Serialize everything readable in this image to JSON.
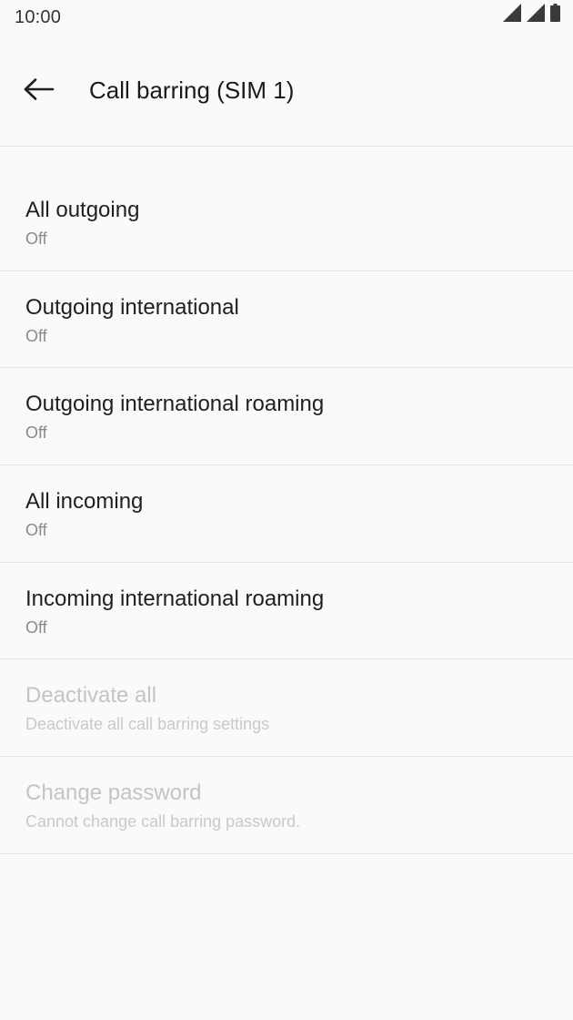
{
  "status_bar": {
    "time": "10:00",
    "icons": [
      "signal-icon",
      "signal-icon",
      "battery-icon"
    ]
  },
  "toolbar": {
    "back_icon": "arrow-back-icon",
    "title": "Call barring (SIM 1)"
  },
  "items": [
    {
      "title": "All outgoing",
      "summary": "Off",
      "enabled": true
    },
    {
      "title": "Outgoing international",
      "summary": "Off",
      "enabled": true
    },
    {
      "title": "Outgoing international roaming",
      "summary": "Off",
      "enabled": true
    },
    {
      "title": "All incoming",
      "summary": "Off",
      "enabled": true
    },
    {
      "title": "Incoming international roaming",
      "summary": "Off",
      "enabled": true
    },
    {
      "title": "Deactivate all",
      "summary": "Deactivate all call barring settings",
      "enabled": false
    },
    {
      "title": "Change password",
      "summary": "Cannot change call barring password.",
      "enabled": false
    }
  ],
  "colors": {
    "background": "#fafafa",
    "text_primary": "#1f1f1f",
    "text_secondary": "#8a8a8a",
    "text_disabled": "#c4c4c4",
    "divider": "#e3e3e3"
  }
}
